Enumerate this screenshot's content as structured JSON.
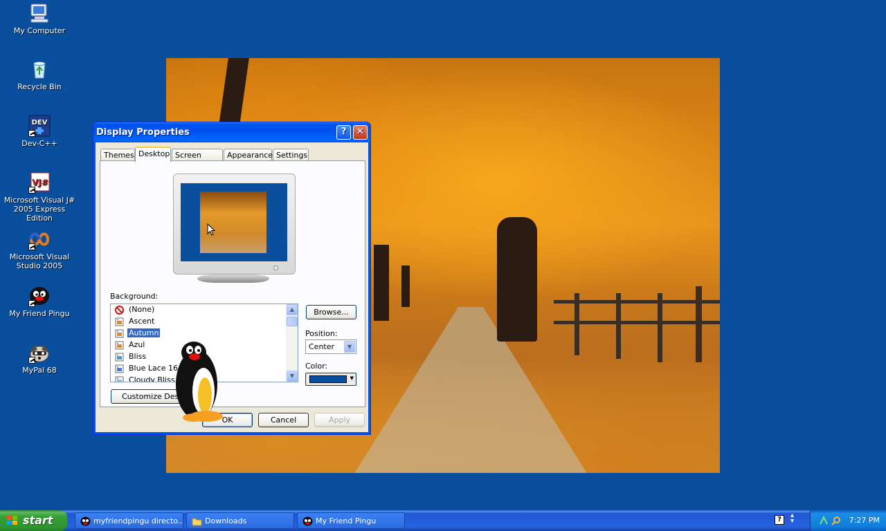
{
  "desktop": {
    "icons": [
      {
        "label": "My Computer",
        "icon": "my-computer-icon"
      },
      {
        "label": "Recycle Bin",
        "icon": "recycle-bin-icon"
      },
      {
        "label": "Dev-C++",
        "icon": "dev-cpp-icon"
      },
      {
        "label": "Microsoft Visual J# 2005 Express Edition",
        "icon": "visual-jsharp-icon"
      },
      {
        "label": "Microsoft Visual Studio 2005",
        "icon": "visual-studio-icon"
      },
      {
        "label": "My Friend Pingu",
        "icon": "pingu-icon"
      },
      {
        "label": "MyPal 68",
        "icon": "mypal-icon"
      }
    ]
  },
  "dialog": {
    "title": "Display Properties",
    "help_button": "?",
    "close_button": "✕",
    "tabs": [
      "Themes",
      "Desktop",
      "Screen Saver",
      "Appearance",
      "Settings"
    ],
    "active_tab": "Desktop",
    "background_label": "Background:",
    "background_items": [
      {
        "label": "(None)",
        "icon": "none-icon"
      },
      {
        "label": "Ascent",
        "icon": "image-file-icon"
      },
      {
        "label": "Autumn",
        "icon": "image-file-icon",
        "selected": true
      },
      {
        "label": "Azul",
        "icon": "image-file-icon"
      },
      {
        "label": "Bliss",
        "icon": "image-file-icon"
      },
      {
        "label": "Blue Lace 16",
        "icon": "image-file-icon"
      },
      {
        "label": "Cloudy Bliss",
        "icon": "image-file-icon"
      }
    ],
    "browse_button": "Browse...",
    "position_label": "Position:",
    "position_value": "Center",
    "color_label": "Color:",
    "color_value": "#0a4f9e",
    "customize_button": "Customize Deskto",
    "ok_button": "OK",
    "cancel_button": "Cancel",
    "apply_button": "Apply"
  },
  "taskbar": {
    "start_label": "start",
    "buttons": [
      {
        "label": "myfriendpingu directo...",
        "icon": "pingu-small-icon"
      },
      {
        "label": "Downloads",
        "icon": "folder-icon"
      },
      {
        "label": "My Friend Pingu",
        "icon": "pingu-small-icon"
      }
    ],
    "clock": "7:27 PM"
  }
}
